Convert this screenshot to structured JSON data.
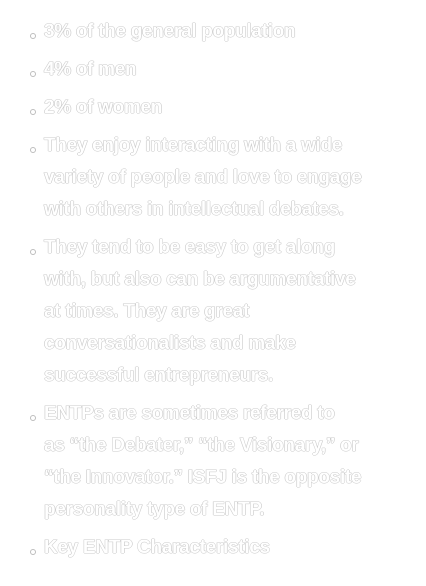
{
  "items": [
    {
      "lines": [
        "3% of the general population"
      ]
    },
    {
      "lines": [
        "4% of men"
      ]
    },
    {
      "lines": [
        "2% of women"
      ]
    },
    {
      "lines": [
        "They enjoy interacting with a wide",
        "variety of people and love to engage",
        "with others in intellectual debates."
      ]
    },
    {
      "lines": [
        "They tend to be easy to get along",
        "with, but also can be argumentative",
        "at times. They are great",
        "conversationalists and make",
        "successful entrepreneurs."
      ]
    },
    {
      "lines": [
        "ENTPs are sometimes referred to",
        "as “the Debater,” “the Visionary,” or",
        "“the Innovator.” ISFJ is the opposite",
        "personality type of ENTP."
      ]
    },
    {
      "lines": [
        "Key ENTP Characteristics"
      ]
    }
  ],
  "colors": {
    "text": "#ffffff",
    "outline": "#c8c8c8",
    "background": "#ffffff"
  }
}
